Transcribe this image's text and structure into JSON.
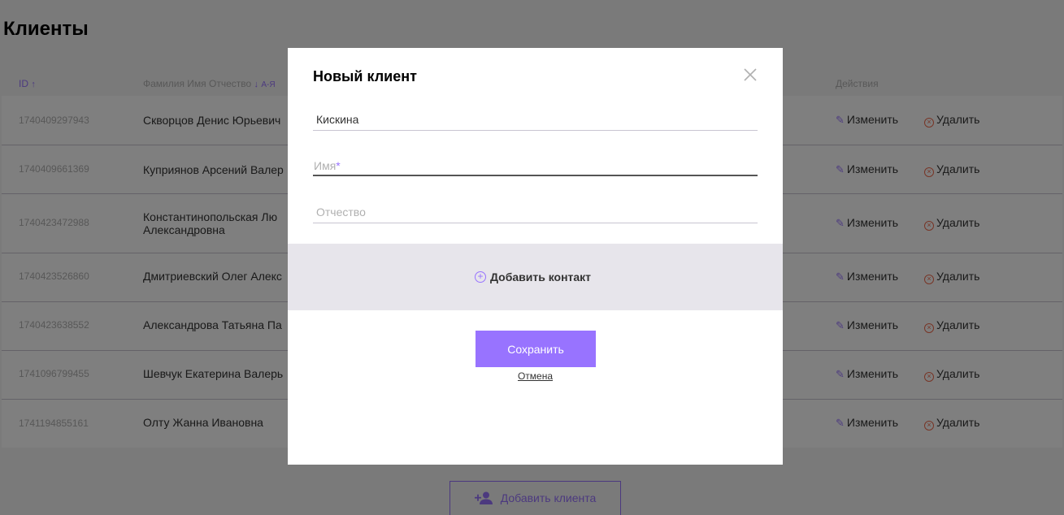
{
  "page": {
    "title": "Клиенты"
  },
  "table": {
    "headers": {
      "id": "ID",
      "fio": "Фамилия Имя Отчество",
      "fio_sort": "А-Я",
      "actions": "Действия"
    },
    "rows": [
      {
        "id": "1740409297943",
        "fio": "Скворцов Денис Юрьевич"
      },
      {
        "id": "1740409661369",
        "fio": "Куприянов Арсений Валер"
      },
      {
        "id": "1740423472988",
        "fio": "Константинопольская Лю Александровна"
      },
      {
        "id": "1740423526860",
        "fio": "Дмитриевский Олег Алекс"
      },
      {
        "id": "1740423638552",
        "fio": "Александрова Татьяна Па"
      },
      {
        "id": "1741096799455",
        "fio": "Шевчук Екатерина Валерь"
      },
      {
        "id": "1741194855161",
        "fio": "Олту Жанна Ивановна"
      }
    ],
    "edit_label": "Изменить",
    "delete_label": "Удалить"
  },
  "add_client_label": "Добавить клиента",
  "modal": {
    "title": "Новый клиент",
    "surname_value": "Кискина",
    "name_placeholder": "Имя",
    "name_required_mark": "*",
    "patronymic_placeholder": "Отчество",
    "add_contact_label": "Добавить контакт",
    "save_label": "Сохранить",
    "cancel_label": "Отмена"
  },
  "colors": {
    "accent": "#9873ff",
    "delete": "#f06a4d",
    "overlay": "rgba(0,0,0,0.5)"
  }
}
